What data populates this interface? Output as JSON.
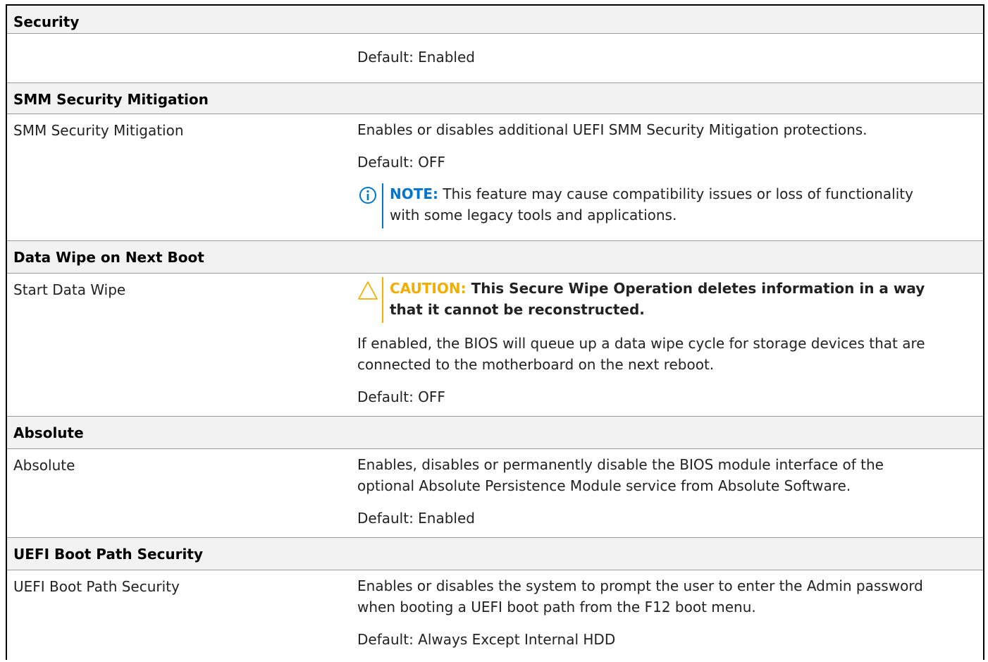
{
  "sections": {
    "security": {
      "title": "Security"
    },
    "smm": {
      "title": "SMM Security Mitigation",
      "option": "SMM Security Mitigation",
      "description": "Enables or disables additional UEFI SMM Security Mitigation protections.",
      "default": "Default: OFF",
      "note_label": "NOTE:",
      "note_line1": " This feature may cause compatibility issues or loss of functionality",
      "note_line2": "with some legacy tools and applications."
    },
    "wipe": {
      "title": "Data Wipe on Next Boot",
      "option": "Start Data Wipe",
      "caution_label": "CAUTION:",
      "caution_line1": " This Secure Wipe Operation deletes information in a way",
      "caution_line2": "that it cannot be reconstructed.",
      "desc_line1": "If enabled, the BIOS will queue up a data wipe cycle for storage devices that are",
      "desc_line2": "connected to the motherboard on the next reboot.",
      "default": "Default: OFF"
    },
    "absolute": {
      "title": "Absolute",
      "option": "Absolute",
      "desc_line1": "Enables, disables or permanently disable the BIOS module interface of the",
      "desc_line2": "optional Absolute Persistence Module service from Absolute Software.",
      "default": "Default: Enabled"
    },
    "uefi": {
      "title": "UEFI Boot Path Security",
      "option": "UEFI Boot Path Security",
      "desc_line1": "Enables or disables the system to prompt the user to enter the Admin password",
      "desc_line2": "when booting a UEFI boot path from the F12 boot menu.",
      "default": "Default: Always Except Internal HDD"
    }
  },
  "top_default": "Default: Enabled",
  "colors": {
    "note_blue": "#0076ce",
    "caution_orange": "#f2af00",
    "header_bg": "#f2f2f2",
    "border": "#9b9b9b"
  },
  "icons": {
    "note": "info-circle-icon",
    "caution": "warning-triangle-icon"
  }
}
